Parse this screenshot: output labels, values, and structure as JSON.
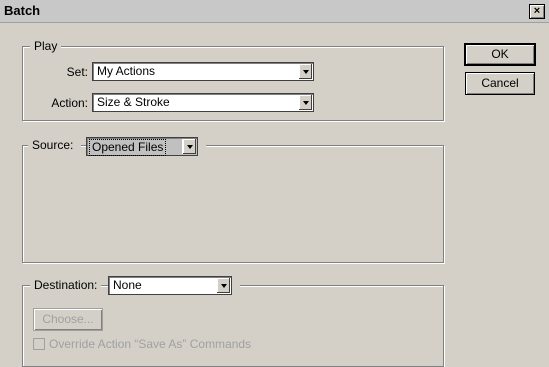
{
  "window": {
    "title": "Batch",
    "close_glyph": "×"
  },
  "play": {
    "legend": "Play",
    "set_label": "Set:",
    "set_value": "My Actions",
    "action_label": "Action:",
    "action_value": "Size & Stroke"
  },
  "source": {
    "label": "Source:",
    "value": "Opened Files"
  },
  "destination": {
    "label": "Destination:",
    "value": "None",
    "choose_label": "Choose...",
    "override_label": "Override Action “Save As” Commands"
  },
  "buttons": {
    "ok": "OK",
    "cancel": "Cancel"
  }
}
